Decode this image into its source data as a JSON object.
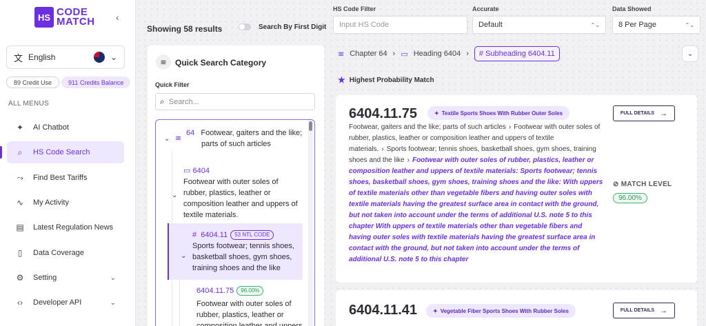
{
  "sidebar": {
    "logo_box": "HS",
    "logo_line1": "CODE",
    "logo_line2": "MATCH",
    "language": "English",
    "credit_use": "89 Credit Use",
    "credit_balance": "911 Credits Balance",
    "all_menus": "ALL MENUS",
    "items": [
      {
        "label": "AI Chatbot"
      },
      {
        "label": "HS Code Search"
      },
      {
        "label": "Find Best Tariffs"
      },
      {
        "label": "My Activity"
      },
      {
        "label": "Latest Regulation News"
      },
      {
        "label": "Data Coverage"
      },
      {
        "label": "Setting"
      },
      {
        "label": "Developer API"
      }
    ]
  },
  "header": {
    "showing": "Showing 58 results",
    "toggle_label": "Search By First Digit",
    "filter_label": "HS Code Filter",
    "filter_placeholder": "Input HS Code",
    "accurate_label": "Accurate",
    "accurate_value": "Default",
    "data_label": "Data Showed",
    "data_value": "8 Per Page"
  },
  "quick_search": {
    "title": "Quick Search Category",
    "filter_label": "Quick Filter",
    "search_placeholder": "Search...",
    "chapter_code": "64",
    "chapter_text_1": "Footwear, gaiters and the like;",
    "chapter_text_2": "parts of such articles",
    "heading_code": "6404",
    "heading_lines": [
      "Footwear with outer soles of",
      "rubber, plastics, leather or",
      "composition leather and uppers of",
      "textile materials."
    ],
    "sub_code": "6404.11",
    "sub_badge": "53 NTL CODE",
    "sub_lines": [
      "Sports footwear; tennis shoes,",
      "basketball shoes, gym shoes,",
      "training shoes and the like"
    ],
    "ntl_code": "6404.11.75",
    "ntl_badge": "96.00%",
    "ntl_lines": [
      "Footwear with outer soles of",
      "rubber, plastics, leather or",
      "composition leather and uppers"
    ]
  },
  "breadcrumb": {
    "chapter": "Chapter 64",
    "heading": "Heading 6404",
    "subheading": "# Subheading 6404.11"
  },
  "highest_match": "Highest Probability Match",
  "results": [
    {
      "code": "6404.11.75",
      "tag": "Textile Sports Shoes With Rubber Outer Soles",
      "button": "FULL DETAILS",
      "desc_1": "Footwear, gaiters and the like; parts of such articles",
      "desc_2": "Footwear with outer soles of rubber, plastics, leather or composition leather and uppers of textile materials.",
      "desc_3": "Sports footwear; tennis shoes, basketball shoes, gym shoes, training shoes and the like",
      "desc_hl": "Footwear with outer soles of rubber, plastics, leather or composition leather and uppers of textile materials: Sports footwear; tennis shoes, basketball shoes, gym shoes, training shoes and the like: With uppers of textile materials other than vegetable fibers and having outer soles with textile materials having the greatest surface area in contact with the ground, but not taken into account under the terms of additional U.S. note 5 to this chapter With uppers of textile materials other than vegetable fibers and having outer soles with textile materials having the greatest surface area in contact with the ground, but not taken into account under the terms of additional U.S. note 5 to this chapter",
      "match_label": "MATCH LEVEL",
      "match_value": "96.00%"
    },
    {
      "code": "6404.11.41",
      "tag": "Vegetable Fiber Sports Shoes With Rubber Soles",
      "button": "FULL DETAILS"
    }
  ]
}
